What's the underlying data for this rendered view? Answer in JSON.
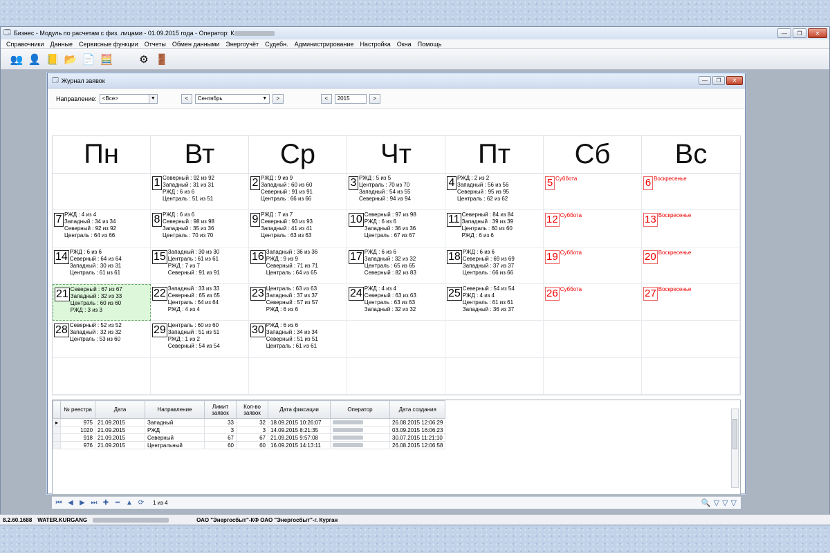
{
  "window": {
    "title": "Бизнес - Модуль по расчетам с физ. лицами - 01.09.2015 года - Оператор: К"
  },
  "menu": [
    "Справочники",
    "Данные",
    "Сервисные функции",
    "Отчеты",
    "Обмен данными",
    "Энергоучёт",
    "Судебн.",
    "Администрирование",
    "Настройка",
    "Окна",
    "Помощь"
  ],
  "toolbar_icons": [
    "users-icon",
    "user-icon",
    "book-icon",
    "folder-icon",
    "document-icon",
    "calculator-icon",
    "gear-icon",
    "exit-icon"
  ],
  "journal": {
    "title": "Журнал заявок"
  },
  "filter": {
    "direction_label": "Направление:",
    "direction_value": "<Все>",
    "month": "Сентябрь",
    "year": "2015",
    "prev": "<",
    "next": ">"
  },
  "weekdays": [
    "Пн",
    "Вт",
    "Ср",
    "Чт",
    "Пт",
    "Сб",
    "Вс"
  ],
  "calendar": {
    "weeks": [
      [
        {
          "day": ""
        },
        {
          "day": "1",
          "lines": [
            "Северный : 92 из 92",
            "Западный : 31 из 31",
            "РЖД : 6 из 6",
            "Централь : 51 из 51"
          ]
        },
        {
          "day": "2",
          "lines": [
            "РЖД : 9 из 9",
            "Западный : 60 из 60",
            "Северный : 91 из 91",
            "Централь : 66 из 66"
          ]
        },
        {
          "day": "3",
          "lines": [
            "РЖД : 5 из 5",
            "Централь : 70 из 70",
            "Западный : 54 из 55",
            "Северный : 94 из 94"
          ]
        },
        {
          "day": "4",
          "lines": [
            "РЖД : 2 из 2",
            "Западный : 56 из 56",
            "Северный : 95 из 95",
            "Централь : 62 из 62"
          ]
        },
        {
          "day": "5",
          "weekend": "Суббота"
        },
        {
          "day": "6",
          "weekend": "Воскресенье"
        }
      ],
      [
        {
          "day": "7",
          "lines": [
            "РЖД : 4 из 4",
            "Западный : 34 из 34",
            "Северный : 92 из 92",
            "Централь : 64 из 66"
          ]
        },
        {
          "day": "8",
          "lines": [
            "РЖД : 6 из 6",
            "Северный : 98 из 98",
            "Западный : 35 из 36",
            "Централь : 70 из 70"
          ]
        },
        {
          "day": "9",
          "lines": [
            "РЖД : 7 из 7",
            "Северный : 93 из 93",
            "Западный : 41 из 41",
            "Централь : 63 из 63"
          ]
        },
        {
          "day": "10",
          "lines": [
            "Северный : 97 из 98",
            "РЖД : 6 из 6",
            "Западный : 36 из 36",
            "Централь : 67 из 67"
          ]
        },
        {
          "day": "11",
          "lines": [
            "Северный : 84 из 84",
            "Западный : 39 из 39",
            "Централь : 60 из 60",
            "РЖД : 6 из 6"
          ]
        },
        {
          "day": "12",
          "weekend": "Суббота"
        },
        {
          "day": "13",
          "weekend": "Воскресенье"
        }
      ],
      [
        {
          "day": "14",
          "lines": [
            "РЖД : 6 из 6",
            "Северный : 64 из 64",
            "Западный : 30 из 31",
            "Централь : 61 из 61"
          ]
        },
        {
          "day": "15",
          "lines": [
            "Западный : 30 из 30",
            "Централь : 61 из 61",
            "РЖД : 7 из 7",
            "Северный : 91 из 91"
          ]
        },
        {
          "day": "16",
          "lines": [
            "Западный : 36 из 36",
            "РЖД : 9 из 9",
            "Северный : 71 из 71",
            "Централь : 64 из 65"
          ]
        },
        {
          "day": "17",
          "lines": [
            "РЖД : 6 из 6",
            "Западный : 32 из 32",
            "Централь : 65 из 65",
            "Северный : 82 из 83"
          ]
        },
        {
          "day": "18",
          "lines": [
            "РЖД : 6 из 6",
            "Северный : 69 из 69",
            "Западный : 37 из 37",
            "Централь : 66 из 66"
          ]
        },
        {
          "day": "19",
          "weekend": "Суббота"
        },
        {
          "day": "20",
          "weekend": "Воскресенье"
        }
      ],
      [
        {
          "day": "21",
          "selected": true,
          "lines": [
            "Северный : 67 из 67",
            "Западный : 32 из 33",
            "Централь : 60 из 60",
            "РЖД : 3 из 3"
          ]
        },
        {
          "day": "22",
          "lines": [
            "Западный : 33 из 33",
            "Северный : 65 из 65",
            "Централь : 64 из 64",
            "РЖД : 4 из 4"
          ]
        },
        {
          "day": "23",
          "lines": [
            "Централь : 63 из 63",
            "Западный : 37 из 37",
            "Северный : 57 из 57",
            "РЖД : 6 из 6"
          ]
        },
        {
          "day": "24",
          "lines": [
            "РЖД : 4 из 4",
            "Северный : 63 из 63",
            "Централь : 63 из 63",
            "Западный : 32 из 32"
          ]
        },
        {
          "day": "25",
          "lines": [
            "Северный : 54 из 54",
            "РЖД : 4 из 4",
            "Централь : 61 из 61",
            "Западный : 36 из 37"
          ]
        },
        {
          "day": "26",
          "weekend": "Суббота"
        },
        {
          "day": "27",
          "weekend": "Воскресенье"
        }
      ],
      [
        {
          "day": "28",
          "lines": [
            "Северный : 52 из 52",
            "Западный : 32 из 32",
            "Централь : 53 из 60"
          ]
        },
        {
          "day": "29",
          "lines": [
            "Централь : 60 из 60",
            "Западный : 51 из 51",
            "РЖД : 1 из 2",
            "Северный : 54 из 54"
          ]
        },
        {
          "day": "30",
          "lines": [
            "РЖД : 6 из 6",
            "Западный : 34 из 34",
            "Северный : 51 из 51",
            "Централь : 61 из 61"
          ]
        },
        {
          "day": ""
        },
        {
          "day": ""
        },
        {
          "day": ""
        },
        {
          "day": ""
        }
      ],
      [
        {
          "day": ""
        },
        {
          "day": ""
        },
        {
          "day": ""
        },
        {
          "day": ""
        },
        {
          "day": ""
        },
        {
          "day": ""
        },
        {
          "day": ""
        }
      ]
    ]
  },
  "table": {
    "headers": [
      "№ реестра",
      "Дата",
      "Направление",
      "Лимит заявок",
      "Кол-во заявок",
      "Дата фиксации",
      "Оператор",
      "Дата создания"
    ],
    "rows": [
      [
        "975",
        "21.09.2015",
        "Западный",
        "33",
        "32",
        "18.09.2015 10:26:07",
        "",
        "26.08.2015 12:06:29"
      ],
      [
        "1020",
        "21.09.2015",
        "РЖД",
        "3",
        "3",
        "14.09.2015 8:21:35",
        "",
        "03.09.2015 16:06:23"
      ],
      [
        "918",
        "21.09.2015",
        "Северный",
        "67",
        "67",
        "21.09.2015 9:57:08",
        "",
        "30.07.2015 11:21:10"
      ],
      [
        "976",
        "21.09.2015",
        "Центральный",
        "60",
        "60",
        "16.09.2015 14:13:11",
        "",
        "26.08.2015 12:06:58"
      ]
    ]
  },
  "navbar": {
    "record": "1 из 4"
  },
  "status": {
    "version": "8.2.60.1688",
    "db": "WATER.KURGANG",
    "org": "ОАО \"Энергосбыт\"-КФ ОАО \"Энергосбыт\"-г. Курган"
  }
}
